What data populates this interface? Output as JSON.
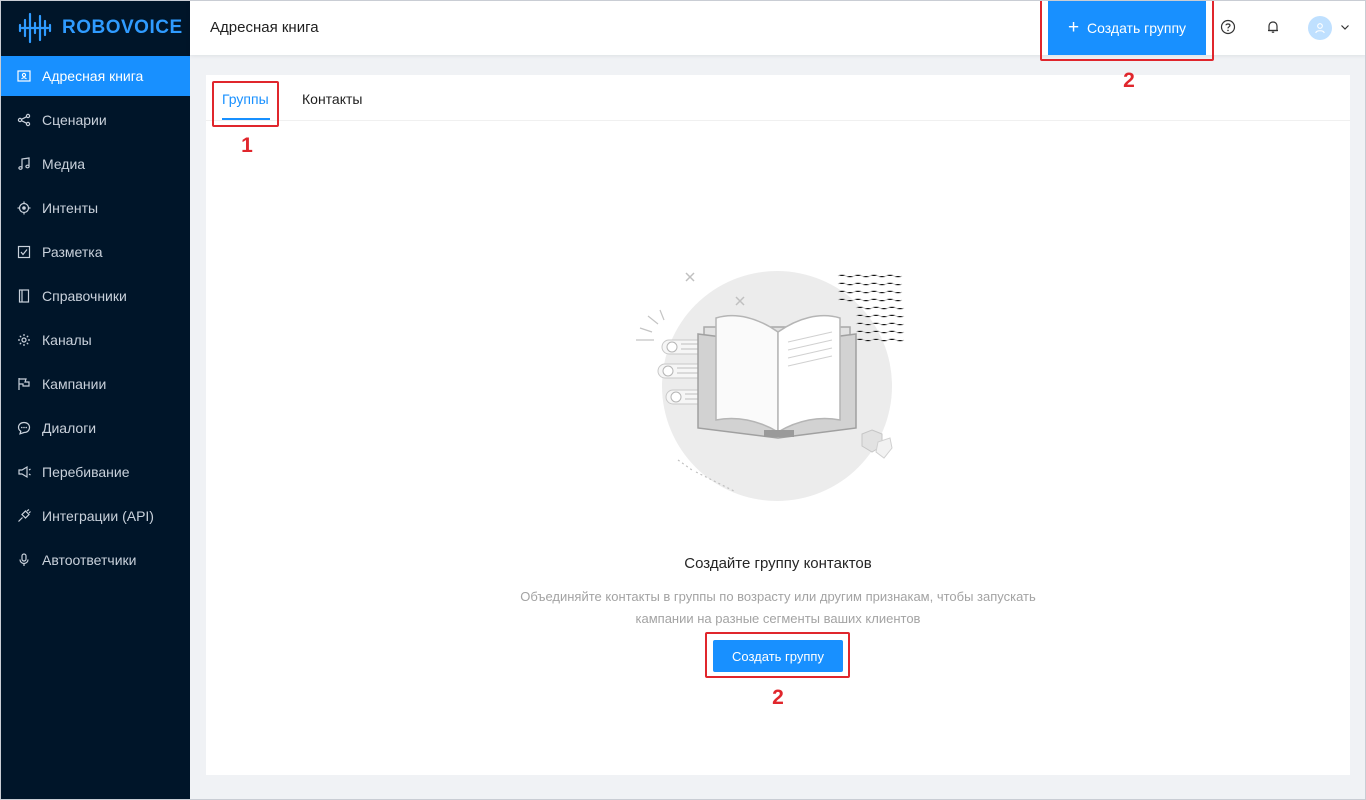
{
  "brand": {
    "name": "ROBOVOICE",
    "color": "#2f9bff"
  },
  "colors": {
    "accent": "#1890ff",
    "sidebar_bg": "#001529",
    "annotation": "#e0262c"
  },
  "sidebar": {
    "items": [
      {
        "label": "Адресная книга",
        "icon": "address-book-icon",
        "active": true
      },
      {
        "label": "Сценарии",
        "icon": "share-nodes-icon"
      },
      {
        "label": "Медиа",
        "icon": "music-note-icon"
      },
      {
        "label": "Интенты",
        "icon": "target-icon"
      },
      {
        "label": "Разметка",
        "icon": "checkbox-icon"
      },
      {
        "label": "Справочники",
        "icon": "book-icon"
      },
      {
        "label": "Каналы",
        "icon": "gear-icon"
      },
      {
        "label": "Кампании",
        "icon": "flag-icon"
      },
      {
        "label": "Диалоги",
        "icon": "chat-icon"
      },
      {
        "label": "Перебивание",
        "icon": "megaphone-icon"
      },
      {
        "label": "Интеграции (API)",
        "icon": "plug-icon"
      },
      {
        "label": "Автоответчики",
        "icon": "microphone-icon"
      }
    ]
  },
  "header": {
    "title": "Адресная книга",
    "create_button": "Создать группу",
    "icons": [
      "help-icon",
      "bell-icon",
      "user-avatar-icon",
      "chevron-down-icon"
    ]
  },
  "tabs": [
    {
      "label": "Группы",
      "active": true
    },
    {
      "label": "Контакты",
      "active": false
    }
  ],
  "empty_state": {
    "title": "Создайте группу контактов",
    "description_line1": "Объединяйте контакты в группы по возрасту или другим признакам, чтобы запускать",
    "description_line2": "кампании на разные сегменты ваших клиентов",
    "button": "Создать группу"
  },
  "annotations": {
    "tabs_marker": "1",
    "header_button_marker": "2",
    "empty_button_marker": "2"
  }
}
